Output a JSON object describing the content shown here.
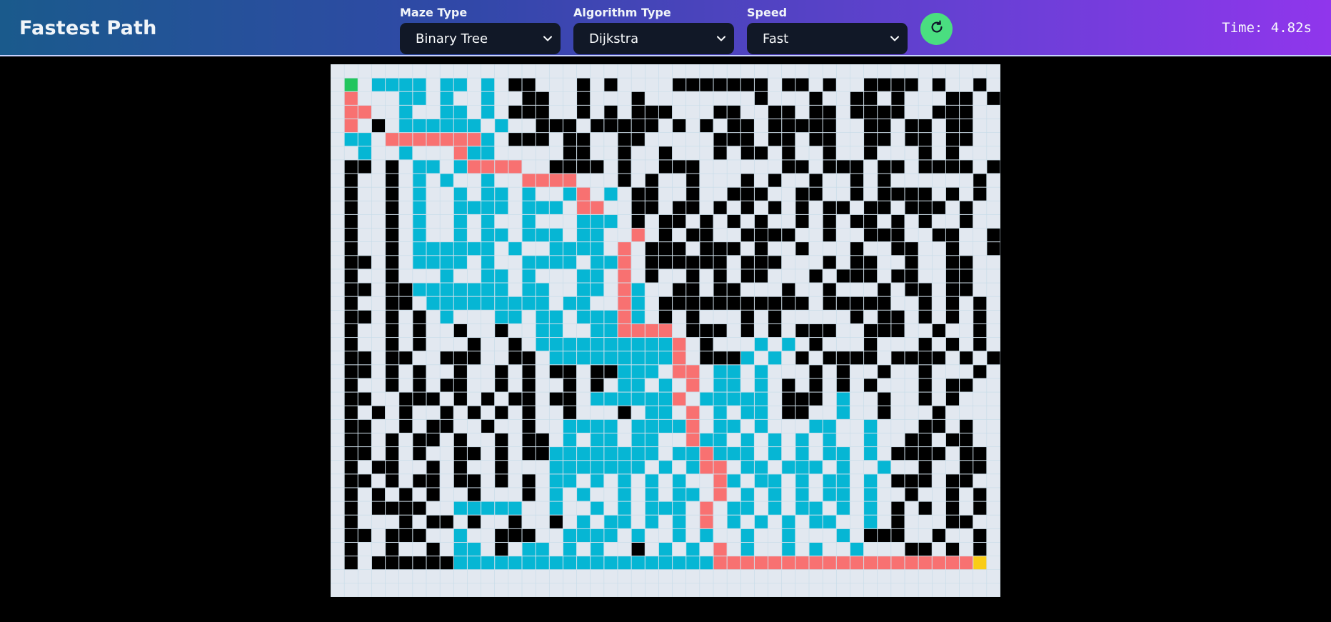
{
  "app": {
    "title": "Fastest Path"
  },
  "controls": {
    "maze_type": {
      "label": "Maze Type",
      "value": "Binary Tree"
    },
    "algorithm": {
      "label": "Algorithm Type",
      "value": "Dijkstra"
    },
    "speed": {
      "label": "Speed",
      "value": "Fast"
    }
  },
  "icons": {
    "reset": "refresh-icon",
    "dropdown": "chevron-down-icon"
  },
  "timer": {
    "label": "Time:",
    "value": "4.82s"
  },
  "colors": {
    "background": "#000000",
    "board": "#e2e8f0",
    "wall": "#000000",
    "visited": "#06b6d4",
    "path": "#f87171",
    "start": "#22c55e",
    "end": "#facc15",
    "reset_button": "#4ade80",
    "select_bg": "#111827"
  },
  "maze": {
    "rows": 39,
    "cols": 49,
    "legend": {
      "#": "wall",
      ".": "open",
      "v": "visited",
      "p": "path",
      "S": "start",
      "E": "end"
    },
    "grid": [
      ".................................................",
      ".S.vvvv.vv.v.##...#.#....#######.##.#..####.#..#.",
      ".p...vv.v..v..##..#...#........#...#..##.#...##.#",
      ".pp..v..vv.v.###..#.#.###...##..##.##.####..###..",
      ".p.#.vvvvvv.v..###.#####.#.#.##.#####..##.##.##..",
      ".vv.pppppppv.###.##..##.....###.##.##..##.##.##..",
      "..v..v...pvv.....##..#..#...#.##.#..#..#...#.#...",
      ".##.#.vv.vpppp..####.#..###......##.###.##.####.#",
      ".#..#.v.v..v..pppp...#.#..#...#.#..#..#.#......#.",
      ".#..#.v..v.vv.v..vp.v.##..#..###..##..#.####.#.#.",
      ".#..#.v..vvvv.vvv.pp..##.##.#.#.#.#.##.##.###.#..",
      ".#..#.v..v.v..v...vvv.#.##.#.#.#..#.#.##.#.#..#..",
      ".#..#.v..v.vv.vvv.vv..p.#.##..####..#..###..##..#",
      ".#..#.vvvvvv.v..vvvv.p.###.###.#..#...#..##..#..#",
      ".##.#.vvvv.v..vvvv.vvp.######.###...#.##..#..##..",
      ".#..#...v..vv.v...vv.p.#..#.#.##...#.###.##..##..",
      ".##.##vvvvvvv.vv..vv.pv..##.##...#..#...#.##.##..",
      ".#..##.vvvvvvvvv.vv..pv.###########.#####..#.#.#.",
      ".##.#.#.v...vv.vv.vvvpv.#.#...#.#.....#.##.#.#.#.",
      ".#..#.#..#..#..vv..vvpppp.###.#.#.###..###..#..#.",
      ".#..#.#...#..#.vvvvvvvvvvp.#...v.v.#...#...#.#.#.",
      ".##.##..###..##.vvvvvvvvvp.###v.v.#.####.####.#.#",
      ".##.#.#..#..#.#.##.##vvv.pp.vv.v...#.#..#..#...#.",
      ".#..#.#.##..#.#..#.#.vv.v.p.vv.v.#.#.#.#...#.##..",
      ".##..###.#.#.##.##.vvvvvvp.vvvvv.###.v..#..#.#...",
      ".#.#.#..#.#.#.#..#...#.vv.p.v.vv.##..v..#...#....",
      ".##..#.##..#..#..vvvv.vvvvp.vv.v...vv..v...##.#..",
      ".##.#.##.#..#.##.v.vv.vv..pvv.v.v.v.v..v..##.##..",
      ".##.#.#..##.#.##vvvvvvvv.vvpvvv.v.v.vv.v.####.##.",
      ".#.##..#.#..#...vvvvvvv.v.vpp.vv.vvv.v..v..#..##.",
      ".##.#.##.##.#.#.vv.v.v.v.v..pv.vv.v.vv.v.###.##..",
      ".#.#.#.#..#...#.v.v..v.v.vv.p.v.v.v.vv.v..#..#.#.",
      ".#.####..vvvvv..v..v.v.vvv.p.vv.v.vv.v.v.#.#.#.#.",
      ".#...#.##.#..#..#.v.vv.v.v.p.v.v.v.vv..v.#...##..",
      ".##.###..v..###..vvvv.v..v.v..v..v...v.###..#..#.",
      ".#..#..#.vv.#.vv.v.v..#.v.v.p.v..v.v..v...##.#.#.",
      ".#.######vvvvvvvvvvvvvvvvvvvpppppppppppppppppppE.",
      "................................................."
    ]
  }
}
